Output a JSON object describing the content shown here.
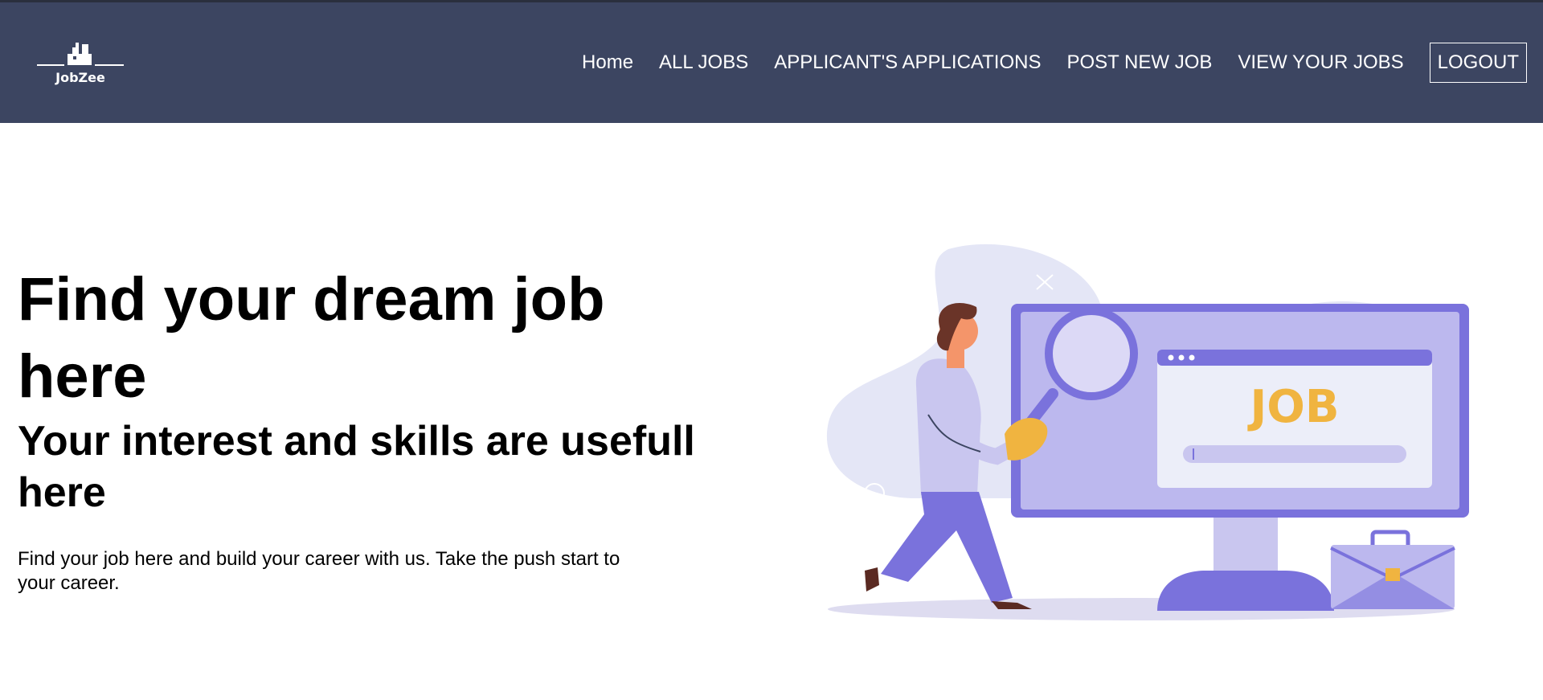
{
  "brand": {
    "name": "JobZee",
    "logo_icon": "briefcase-city-logo-icon"
  },
  "nav": {
    "items": [
      {
        "label": "Home"
      },
      {
        "label": "ALL JOBS"
      },
      {
        "label": "APPLICANT'S APPLICATIONS"
      },
      {
        "label": "POST NEW JOB"
      },
      {
        "label": "VIEW YOUR JOBS"
      }
    ],
    "logout_label": "LOGOUT"
  },
  "hero": {
    "title": "Find your dream job here",
    "subtitle": "Your interest and skills are usefull here",
    "description": "Find your job here and build your career with us. Take the push start to your career."
  },
  "illustration": {
    "screen_word": "JOB",
    "icon": "job-search-illustration"
  },
  "colors": {
    "navbar": "#3c4561",
    "accent_purple": "#7a72dc",
    "accent_orange": "#f0b440"
  }
}
